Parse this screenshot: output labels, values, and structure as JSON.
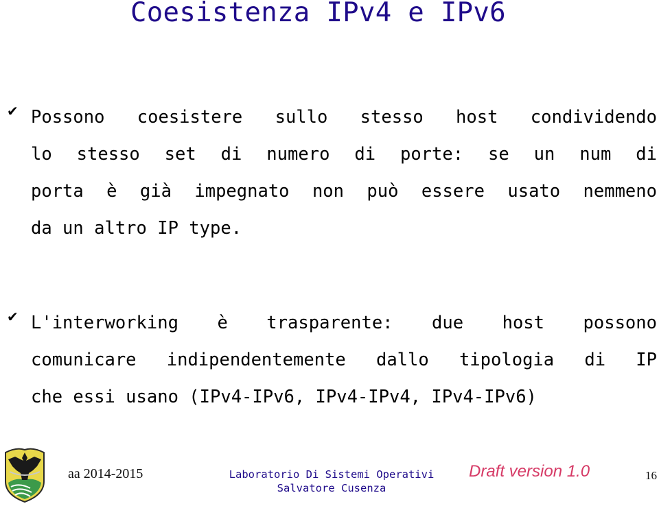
{
  "slide": {
    "title": "Coesistenza IPv4 e IPv6",
    "bullets": [
      {
        "icon": "check-icon",
        "lines": [
          "Possono coesistere sullo stesso host condividendo",
          "lo stesso set di numero di porte: se un num di",
          "porta è già impegnato non può essere usato nemmeno",
          "da un altro IP type."
        ]
      },
      {
        "icon": "check-icon",
        "lines": [
          "L'interworking è trasparente: due host possono",
          "comunicare indipendentemente dallo tipologia di IP",
          "che essi usano (IPv4-IPv6, IPv4-IPv4, IPv4-IPv6)"
        ]
      }
    ]
  },
  "footer": {
    "academic_year": "aa 2014-2015",
    "course": "Laboratorio Di Sistemi Operativi",
    "author": "Salvatore Cusenza",
    "draft_label": "Draft version 1.0",
    "page_number": "16"
  },
  "colors": {
    "title": "#1f0b8a",
    "draft": "#d63a66",
    "text": "#000000"
  },
  "check_glyph": "✔"
}
